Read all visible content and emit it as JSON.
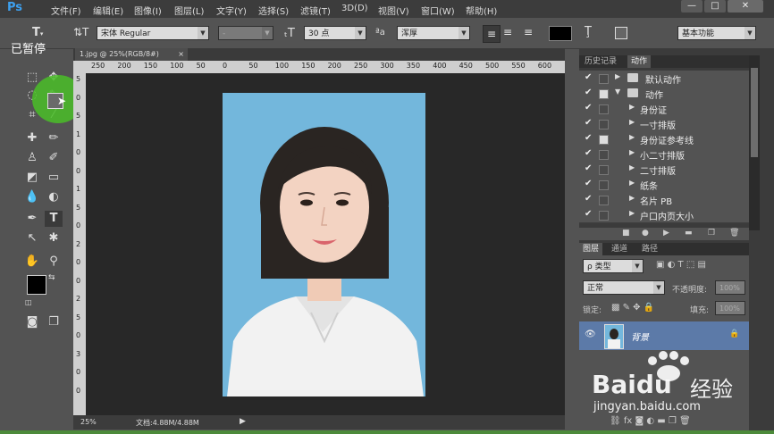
{
  "app": {
    "logo": "Ps"
  },
  "overlay": {
    "paused": "已暂停"
  },
  "menu": [
    "文件(F)",
    "编辑(E)",
    "图像(I)",
    "图层(L)",
    "文字(Y)",
    "选择(S)",
    "滤镜(T)",
    "3D(D)",
    "视图(V)",
    "窗口(W)",
    "帮助(H)"
  ],
  "window_controls": {
    "minimize": "—",
    "maximize": "□",
    "close": "✕"
  },
  "options": {
    "font_family": "宋体 Regular",
    "font_style": "-",
    "font_size": "30 点",
    "aa_label": "ªa",
    "antialias": "浑厚",
    "workspace": "基本功能"
  },
  "document": {
    "tab": "1.jpg @ 25%(RGB/8#)",
    "tab_close": "×",
    "ruler_h": [
      "250",
      "200",
      "150",
      "100",
      "50",
      "0",
      "50",
      "100",
      "150",
      "200",
      "250",
      "300",
      "350",
      "400",
      "450",
      "500",
      "550",
      "600"
    ],
    "ruler_v": [
      "5",
      "0",
      "5",
      "1",
      "0",
      "0",
      "1",
      "5",
      "0",
      "2",
      "0",
      "0",
      "2",
      "5",
      "0",
      "3",
      "0",
      "0"
    ],
    "zoom": "25%",
    "doc_info": "文档:4.88M/4.88M"
  },
  "panels": {
    "history_tab": "历史记录",
    "actions_tab": "动作",
    "actions": [
      {
        "label": "默认动作",
        "folder": true,
        "open": false,
        "level": 0,
        "dialog": false
      },
      {
        "label": "动作",
        "folder": true,
        "open": true,
        "level": 0,
        "dialog": true
      },
      {
        "label": "身份证",
        "folder": false,
        "open": false,
        "level": 1,
        "dialog": false
      },
      {
        "label": "一寸排版",
        "folder": false,
        "open": false,
        "level": 1,
        "dialog": false
      },
      {
        "label": "身份证参考线",
        "folder": false,
        "open": false,
        "level": 1,
        "dialog": true
      },
      {
        "label": "小二寸排版",
        "folder": false,
        "open": false,
        "level": 1,
        "dialog": false
      },
      {
        "label": "二寸排版",
        "folder": false,
        "open": false,
        "level": 1,
        "dialog": false
      },
      {
        "label": "纸条",
        "folder": false,
        "open": false,
        "level": 1,
        "dialog": false
      },
      {
        "label": "名片 PB",
        "folder": false,
        "open": false,
        "level": 1,
        "dialog": false
      },
      {
        "label": "户口内页大小",
        "folder": false,
        "open": false,
        "level": 1,
        "dialog": false
      }
    ],
    "layers_tab": "图层",
    "channels_tab": "通道",
    "paths_tab": "路径",
    "kind_filter": "ρ 类型",
    "blend_mode": "正常",
    "opacity_label": "不透明度:",
    "opacity_value": "100%",
    "lock_label": "锁定:",
    "fill_label": "填充:",
    "fill_value": "100%",
    "layer_name": "背景"
  },
  "watermark": {
    "brand": "Bai",
    "brand2": "du",
    "cn": "经验",
    "url": "jingyan.baidu.com"
  }
}
